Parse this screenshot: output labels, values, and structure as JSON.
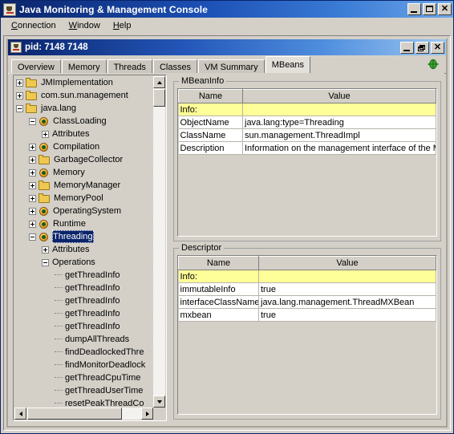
{
  "window": {
    "title": "Java Monitoring & Management Console",
    "icon": "java-cup-icon",
    "controls": {
      "minimize": "–",
      "maximize": "□",
      "close": "✕"
    }
  },
  "menubar": {
    "items": [
      {
        "pre": "",
        "mnemonic": "C",
        "post": "onnection"
      },
      {
        "pre": "",
        "mnemonic": "W",
        "post": "indow"
      },
      {
        "pre": "",
        "mnemonic": "H",
        "post": "elp"
      }
    ]
  },
  "internal_frame": {
    "title": "pid: 7148 7148",
    "icon": "java-cup-icon",
    "controls": {
      "minimize": "–",
      "restore": "❐",
      "close": "✕"
    }
  },
  "tabs": {
    "items": [
      {
        "label": "Overview",
        "active": false
      },
      {
        "label": "Memory",
        "active": false
      },
      {
        "label": "Threads",
        "active": false
      },
      {
        "label": "Classes",
        "active": false
      },
      {
        "label": "VM Summary",
        "active": false
      },
      {
        "label": "MBeans",
        "active": true
      }
    ],
    "connection_icon": "connected-indicator-icon"
  },
  "tree": {
    "nodes": [
      {
        "label": "JMImplementation",
        "depth": 0,
        "handle": "plus",
        "icon": "folder"
      },
      {
        "label": "com.sun.management",
        "depth": 0,
        "handle": "plus",
        "icon": "folder"
      },
      {
        "label": "java.lang",
        "depth": 0,
        "handle": "minus",
        "icon": "folder"
      },
      {
        "label": "ClassLoading",
        "depth": 1,
        "handle": "minus",
        "icon": "mbean"
      },
      {
        "label": "Attributes",
        "depth": 2,
        "handle": "plus",
        "icon": "none"
      },
      {
        "label": "Compilation",
        "depth": 1,
        "handle": "plus",
        "icon": "mbean"
      },
      {
        "label": "GarbageCollector",
        "depth": 1,
        "handle": "plus",
        "icon": "folder"
      },
      {
        "label": "Memory",
        "depth": 1,
        "handle": "plus",
        "icon": "mbean"
      },
      {
        "label": "MemoryManager",
        "depth": 1,
        "handle": "plus",
        "icon": "folder"
      },
      {
        "label": "MemoryPool",
        "depth": 1,
        "handle": "plus",
        "icon": "folder"
      },
      {
        "label": "OperatingSystem",
        "depth": 1,
        "handle": "plus",
        "icon": "mbean"
      },
      {
        "label": "Runtime",
        "depth": 1,
        "handle": "plus",
        "icon": "mbean"
      },
      {
        "label": "Threading",
        "depth": 1,
        "handle": "minus",
        "icon": "mbean",
        "selected": true
      },
      {
        "label": "Attributes",
        "depth": 2,
        "handle": "plus",
        "icon": "none"
      },
      {
        "label": "Operations",
        "depth": 2,
        "handle": "minus",
        "icon": "none"
      },
      {
        "label": "getThreadInfo",
        "depth": 3,
        "handle": "leaf",
        "icon": "none"
      },
      {
        "label": "getThreadInfo",
        "depth": 3,
        "handle": "leaf",
        "icon": "none"
      },
      {
        "label": "getThreadInfo",
        "depth": 3,
        "handle": "leaf",
        "icon": "none"
      },
      {
        "label": "getThreadInfo",
        "depth": 3,
        "handle": "leaf",
        "icon": "none"
      },
      {
        "label": "getThreadInfo",
        "depth": 3,
        "handle": "leaf",
        "icon": "none"
      },
      {
        "label": "dumpAllThreads",
        "depth": 3,
        "handle": "leaf",
        "icon": "none"
      },
      {
        "label": "findDeadlockedThre",
        "depth": 3,
        "handle": "leaf",
        "icon": "none"
      },
      {
        "label": "findMonitorDeadlock",
        "depth": 3,
        "handle": "leaf",
        "icon": "none"
      },
      {
        "label": "getThreadCpuTime",
        "depth": 3,
        "handle": "leaf",
        "icon": "none"
      },
      {
        "label": "getThreadUserTime",
        "depth": 3,
        "handle": "leaf",
        "icon": "none"
      },
      {
        "label": "resetPeakThreadCo",
        "depth": 3,
        "handle": "leaf",
        "icon": "none"
      }
    ]
  },
  "mbean_info": {
    "title": "MBeanInfo",
    "columns": [
      "Name",
      "Value"
    ],
    "rows": [
      {
        "name": "Info:",
        "value": "",
        "highlight": true
      },
      {
        "name": "ObjectName",
        "value": "java.lang:type=Threading",
        "highlight": false
      },
      {
        "name": "ClassName",
        "value": "sun.management.ThreadImpl",
        "highlight": false
      },
      {
        "name": "Description",
        "value": "Information on the management interface of the MBean",
        "highlight": false
      }
    ]
  },
  "descriptor": {
    "title": "Descriptor",
    "columns": [
      "Name",
      "Value"
    ],
    "rows": [
      {
        "name": "Info:",
        "value": "",
        "highlight": true
      },
      {
        "name": "immutableInfo",
        "value": "true",
        "highlight": false
      },
      {
        "name": "interfaceClassName",
        "value": "java.lang.management.ThreadMXBean",
        "highlight": false
      },
      {
        "name": "mxbean",
        "value": "true",
        "highlight": false
      }
    ]
  },
  "colors": {
    "titlebar_start": "#0a246a",
    "titlebar_end": "#6ea6e8",
    "face": "#d4d0c8",
    "info_row": "#ffff99",
    "selection": "#0a246a",
    "connected": "#2f9e2f"
  }
}
